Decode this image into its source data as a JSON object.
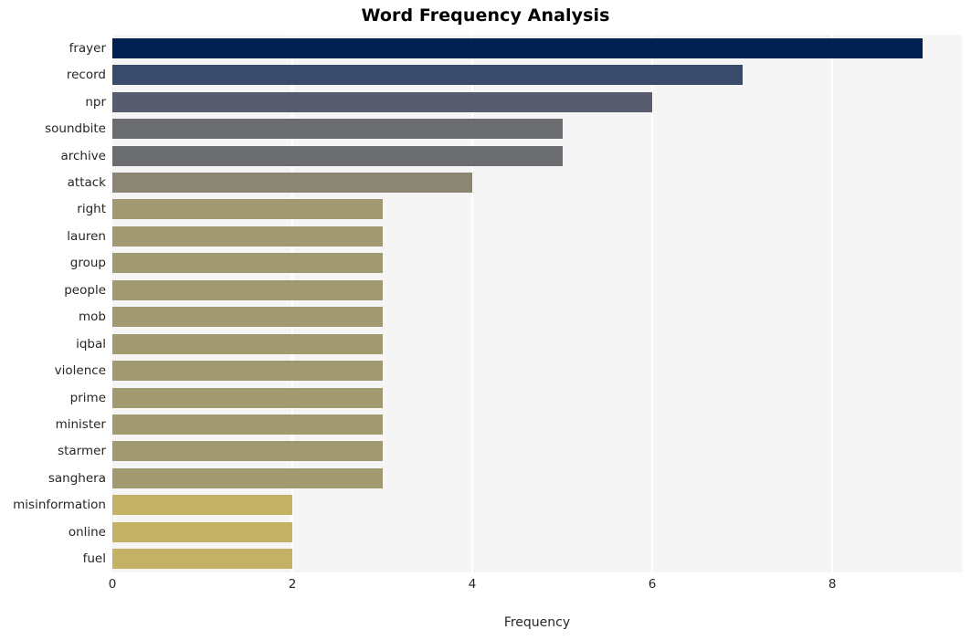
{
  "chart_data": {
    "type": "bar",
    "orientation": "horizontal",
    "title": "Word Frequency Analysis",
    "xlabel": "Frequency",
    "ylabel": "",
    "categories": [
      "frayer",
      "record",
      "npr",
      "soundbite",
      "archive",
      "attack",
      "right",
      "lauren",
      "group",
      "people",
      "mob",
      "iqbal",
      "violence",
      "prime",
      "minister",
      "starmer",
      "sanghera",
      "misinformation",
      "online",
      "fuel"
    ],
    "values": [
      9,
      7,
      6,
      5,
      5,
      4,
      3,
      3,
      3,
      3,
      3,
      3,
      3,
      3,
      3,
      3,
      3,
      2,
      2,
      2
    ],
    "bar_colors": [
      "#002051",
      "#3a4a6b",
      "#575c6e",
      "#6b6d70",
      "#6b6d70",
      "#8a8574",
      "#a19a70",
      "#a19a70",
      "#a19a70",
      "#a19a70",
      "#a19a70",
      "#a19a70",
      "#a19a70",
      "#a19a70",
      "#a19a70",
      "#a19a70",
      "#a19a70",
      "#c4b264",
      "#c4b264",
      "#c4b264"
    ],
    "xlim": [
      0,
      9.44
    ],
    "xticks": [
      0,
      2,
      4,
      6,
      8
    ],
    "xtick_labels": [
      "0",
      "2",
      "4",
      "6",
      "8"
    ],
    "grid": true,
    "grid_axis": "x",
    "grid_color": "#ffffff",
    "legend": null,
    "plot_background": "#f5f5f5",
    "figure_background": "#ffffff"
  }
}
